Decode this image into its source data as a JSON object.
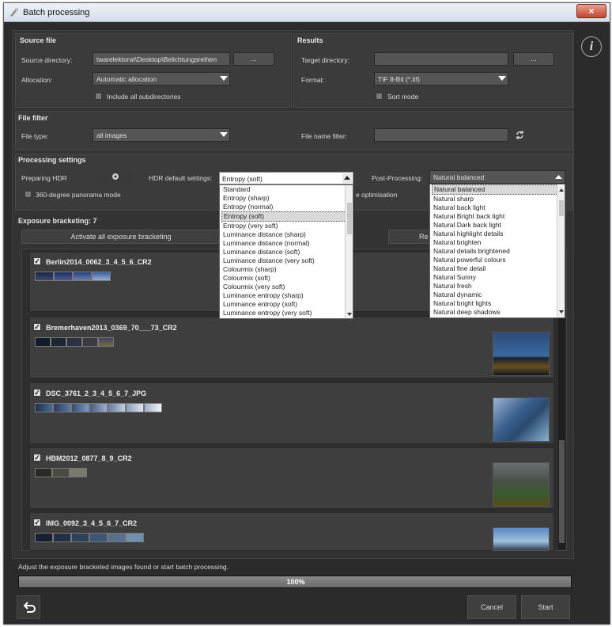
{
  "window": {
    "title": "Batch processing",
    "close": "×"
  },
  "source": {
    "head": "Source file",
    "dir_label": "Source directory:",
    "dir_value": "twarelektorat\\Desktop\\Belichtungsreihen",
    "browse": "...",
    "alloc_label": "Allocation:",
    "alloc_value": "Automatic allocation",
    "subdirs": "Include all subdirectories"
  },
  "results": {
    "head": "Results",
    "target_label": "Target directory:",
    "target_value": "",
    "browse": "...",
    "format_label": "Format:",
    "format_value": "TIF 8-Bit (*.tif)",
    "sort": "Sort mode"
  },
  "filter": {
    "head": "File filter",
    "type_label": "File type:",
    "type_value": "all images",
    "name_label": "File name filter:"
  },
  "processing": {
    "head": "Processing settings",
    "preparing": "Preparing HDR",
    "hdr_label": "HDR default settings:",
    "hdr_value": "Entropy (soft)",
    "post_label": "Post-Processing:",
    "post_value": "Natural balanced",
    "panorama": "360-degree panorama mode",
    "opt": "e optimisation"
  },
  "hdr_options": [
    "Standard",
    "Entropy (sharp)",
    "Entropy (normal)",
    "Entropy (soft)",
    "Entropy (very soft)",
    "Luminance distance (sharp)",
    "Luminance distance (normal)",
    "Luminance distance (soft)",
    "Luminance distance (very soft)",
    "Colourmix (sharp)",
    "Colourmix (soft)",
    "Colourmix (very soft)",
    "Luminance entropy (sharp)",
    "Luminance entropy (soft)",
    "Luminance entropy (very soft)"
  ],
  "post_options": [
    "Natural balanced",
    "Natural sharp",
    "Natural back light",
    "Natural Bright back light",
    "Natural Dark back light",
    "Natural highlight details",
    "Natural brighten",
    "Natural details brightened",
    "Natural powerful colours",
    "Natural fine detail",
    "Natural Sunny",
    "Natural fresh",
    "Natural dynamic",
    "Natural bright lights",
    "Natural deep shadows"
  ],
  "bracketing": {
    "head": "Exposure bracketing: 7",
    "activate": "Activate all exposure bracketing",
    "remove": "Re"
  },
  "items": [
    {
      "name": "Berlin2014_0062_3_4_5_6_CR2"
    },
    {
      "name": "Bremerhaven2013_0369_70___73_CR2"
    },
    {
      "name": "DSC_3761_2_3_4_5_6_7_JPG"
    },
    {
      "name": "HBM2012_0877_8_9_CR2"
    },
    {
      "name": "IMG_0092_3_4_5_6_7_CR2"
    }
  ],
  "status": "Adjust the exposure bracketed images found or start batch processing.",
  "progress": {
    "text": "100%",
    "value": 100
  },
  "buttons": {
    "cancel": "Cancel",
    "start": "Start",
    "info": "i"
  }
}
